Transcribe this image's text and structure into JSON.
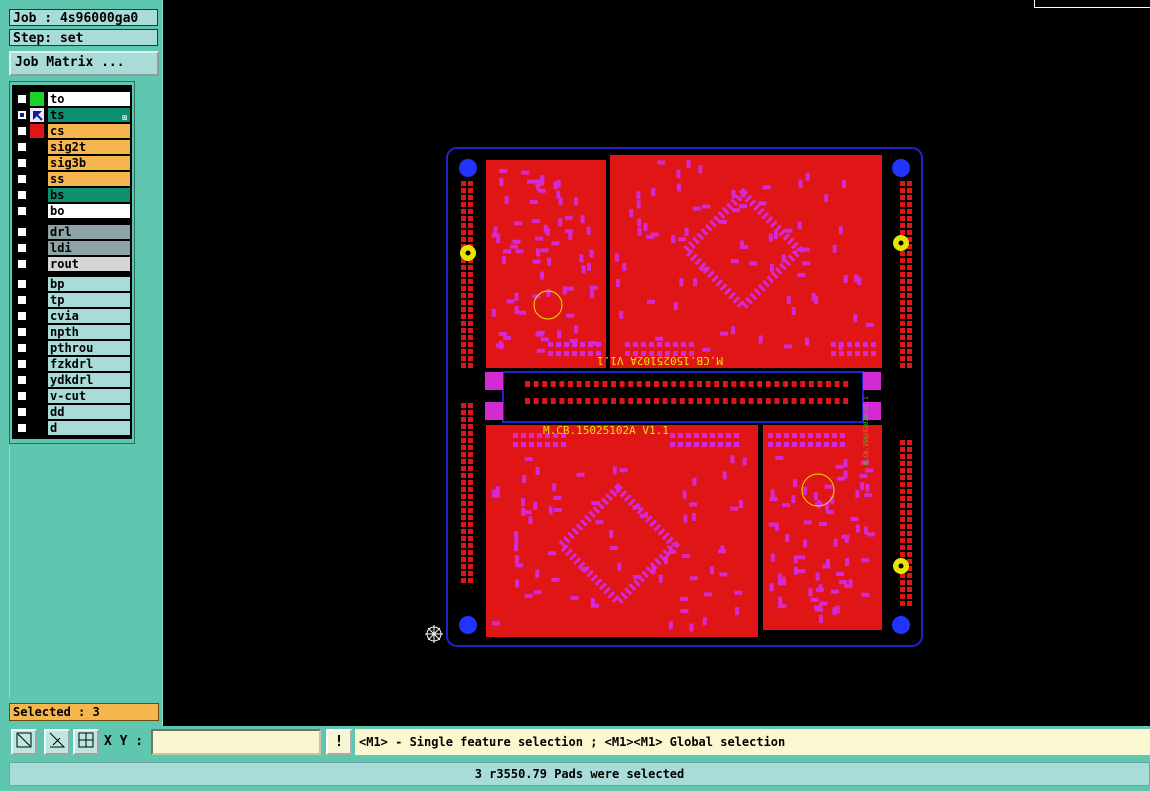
{
  "job": {
    "title": "Job : 4s96000ga0",
    "step": "Step: set",
    "matrix_button": "Job Matrix ..."
  },
  "layers": {
    "group1": [
      {
        "name": "to",
        "bg": "#ffffff",
        "swatch": "#19d22a",
        "checked": false
      },
      {
        "name": "ts",
        "bg": "#0e8f6e",
        "swatch": "#e8e8ff",
        "checked": true,
        "active": true
      },
      {
        "name": "cs",
        "bg": "#f5b74d",
        "swatch": "#e01616",
        "checked": false
      },
      {
        "name": "sig2t",
        "bg": "#f5b74d",
        "swatch": "#000000",
        "checked": false
      },
      {
        "name": "sig3b",
        "bg": "#f5b74d",
        "swatch": "#000000",
        "checked": false
      },
      {
        "name": "ss",
        "bg": "#f5b74d",
        "swatch": "#000000",
        "checked": false
      },
      {
        "name": "bs",
        "bg": "#0e8f6e",
        "swatch": "#000000",
        "checked": false
      },
      {
        "name": "bo",
        "bg": "#ffffff",
        "swatch": "#000000",
        "checked": false
      }
    ],
    "group2": [
      {
        "name": "drl",
        "bg": "#8ea3a6",
        "swatch": "#000000",
        "checked": false
      },
      {
        "name": "ldi",
        "bg": "#8ea3a6",
        "swatch": "#000000",
        "checked": false
      },
      {
        "name": "rout",
        "bg": "#d6d6d6",
        "swatch": "#000000",
        "checked": false
      }
    ],
    "group3": [
      {
        "name": "bp",
        "bg": "#a9dcd8",
        "swatch": "#000000",
        "checked": false
      },
      {
        "name": "tp",
        "bg": "#a9dcd8",
        "swatch": "#000000",
        "checked": false
      },
      {
        "name": "cvia",
        "bg": "#a9dcd8",
        "swatch": "#000000",
        "checked": false
      },
      {
        "name": "npth",
        "bg": "#a9dcd8",
        "swatch": "#000000",
        "checked": false
      },
      {
        "name": "pthrou",
        "bg": "#a9dcd8",
        "swatch": "#000000",
        "checked": false
      },
      {
        "name": "fzkdrl",
        "bg": "#a9dcd8",
        "swatch": "#000000",
        "checked": false
      },
      {
        "name": "ydkdrl",
        "bg": "#a9dcd8",
        "swatch": "#000000",
        "checked": false
      },
      {
        "name": "v-cut",
        "bg": "#a9dcd8",
        "swatch": "#000000",
        "checked": false
      },
      {
        "name": "dd",
        "bg": "#a9dcd8",
        "swatch": "#000000",
        "checked": false
      },
      {
        "name": "d",
        "bg": "#a9dcd8",
        "swatch": "#000000",
        "checked": false
      }
    ]
  },
  "selected_label": "Selected : 3",
  "board": {
    "silk_top_label": "M.CB.15025102A V1.1",
    "silk_bottom_label": "M.CB.15025102A V1.1",
    "silk_side_label": "M.CB.15025102A V1.1",
    "colors": {
      "copper": "#e01616",
      "pad": "#d42ad4",
      "outline": "#2222cc",
      "silk": "#e6e600",
      "drill": "#2233ff"
    }
  },
  "toolbar": {
    "xy_label": "X Y :",
    "xy_value": "",
    "alert_label": "!",
    "hint": "<M1> - Single feature selection ; <M1><M1> Global selection"
  },
  "status": "3 r3550.79 Pads were selected"
}
